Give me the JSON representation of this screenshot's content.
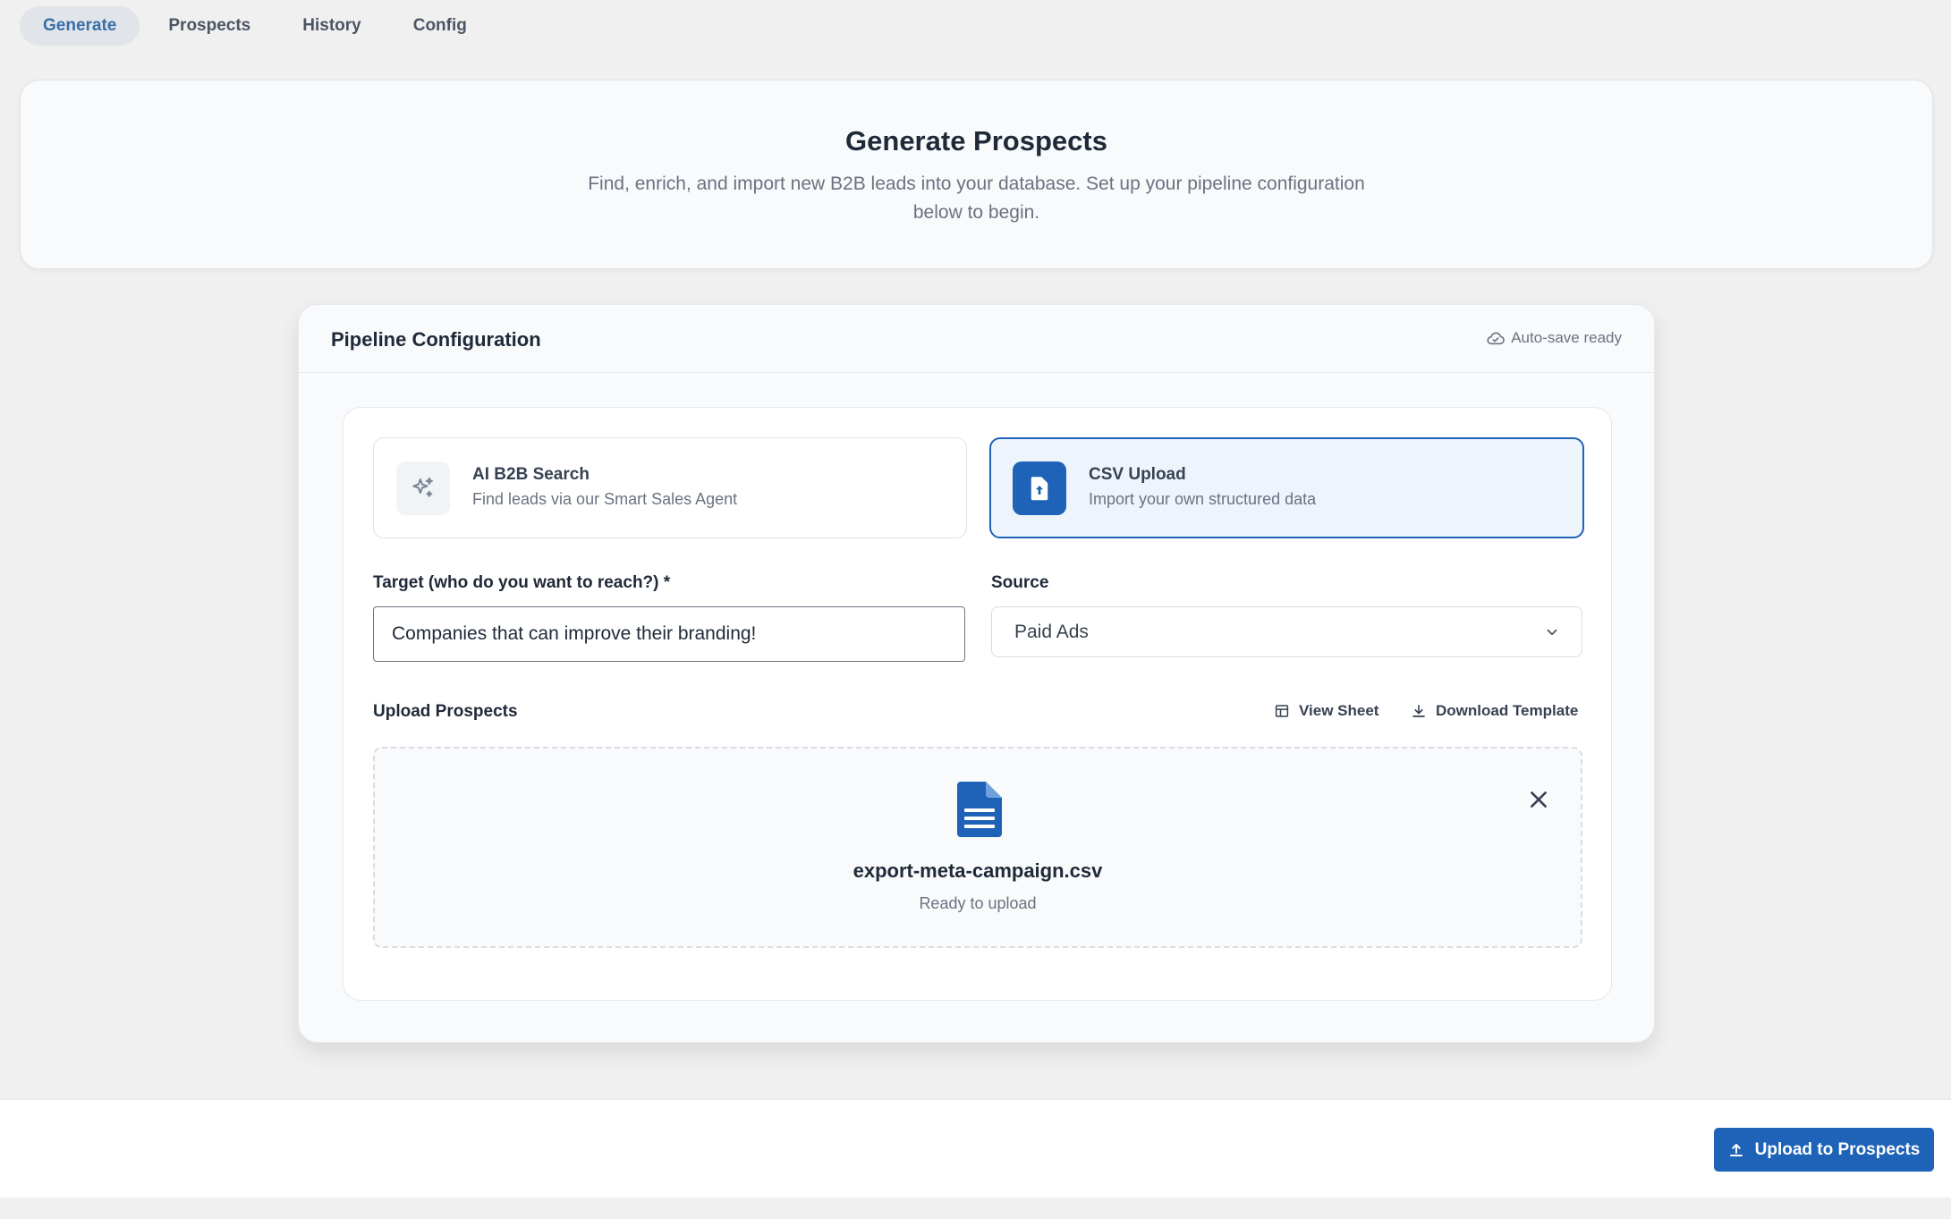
{
  "tabs": [
    {
      "label": "Generate",
      "active": true
    },
    {
      "label": "Prospects",
      "active": false
    },
    {
      "label": "History",
      "active": false
    },
    {
      "label": "Config",
      "active": false
    }
  ],
  "hero": {
    "title": "Generate Prospects",
    "subtitle": "Find, enrich, and import new B2B leads into your database. Set up your pipeline configuration below to begin."
  },
  "pipeline": {
    "title": "Pipeline Configuration",
    "autosave": "Auto-save ready",
    "modes": {
      "ai": {
        "title": "AI B2B Search",
        "subtitle": "Find leads via our Smart Sales Agent",
        "icon": "sparkles-icon"
      },
      "csv": {
        "title": "CSV Upload",
        "subtitle": "Import your own structured data",
        "icon": "file-upload-icon",
        "selected": true
      }
    },
    "target": {
      "label": "Target (who do you want to reach?) *",
      "value": "Companies that can improve their branding!"
    },
    "source": {
      "label": "Source",
      "value": "Paid Ads"
    },
    "upload": {
      "label": "Upload Prospects",
      "view_sheet": "View Sheet",
      "download_template": "Download Template",
      "file_name": "export-meta-campaign.csv",
      "file_status": "Ready to upload"
    }
  },
  "footer": {
    "upload_button": "Upload to Prospects"
  },
  "colors": {
    "accent": "#1e63b8",
    "tab_active_text": "#3a6ea8",
    "background": "#f0f0f0"
  }
}
